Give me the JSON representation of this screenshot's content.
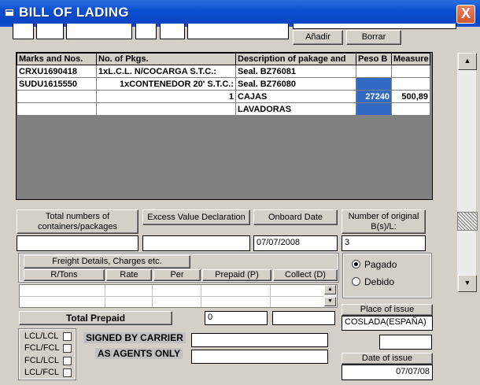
{
  "window": {
    "title": "BILL OF LADING",
    "close_glyph": "X",
    "icon": "app-icon"
  },
  "toolbar": {
    "add_label": "Añadir",
    "delete_label": "Borrar"
  },
  "grid": {
    "headers": [
      "Marks and Nos.",
      "No. of Pkgs.",
      "Description of pakage and",
      "Peso B",
      "Measure"
    ],
    "rows": [
      [
        "CRXU1690418",
        "1xL.C.L. N/COCARGA S.T.C.:",
        "Seal. BZ76081",
        "",
        ""
      ],
      [
        "SUDU1615550",
        "1xCONTENEDOR 20' S.T.C.:",
        "Seal. BZ76080",
        "",
        ""
      ],
      [
        "",
        "1",
        "CAJAS",
        "27240",
        "500,89"
      ],
      [
        "",
        "",
        "LAVADORAS",
        "",
        ""
      ]
    ]
  },
  "totals": {
    "containers_label": "Total numbers of containers/packages",
    "excess_label": "Excess Value Declaration",
    "onboard_label": "Onboard Date",
    "onboard_value": "07/07/2008",
    "original_label": "Number of original B(s)/L:",
    "original_value": "3"
  },
  "freight": {
    "title": "Freight Details, Charges etc.",
    "columns": [
      "R/Tons",
      "Rate",
      "Per",
      "Prepaid (P)",
      "Collect (D)"
    ],
    "total_prepaid_label": "Total Prepaid",
    "total_prepaid_value": "0"
  },
  "payment": {
    "options": [
      "Pagado",
      "Debido"
    ],
    "selected": "Pagado"
  },
  "issue": {
    "place_label": "Place of issue",
    "place_value": "COSLADA(ESPAÑA)",
    "date_label": "Date of issue",
    "date_value": "07/07/08"
  },
  "load_types": [
    "LCL/LCL",
    "FCL/FCL",
    "FCL/LCL",
    "LCL/FCL"
  ],
  "signature": {
    "signed_label": "SIGNED BY CARRIER",
    "agents_label": "AS AGENTS ONLY"
  },
  "icons": {
    "scroll_up": "arrow-up-icon",
    "scroll_down": "arrow-down-icon"
  }
}
